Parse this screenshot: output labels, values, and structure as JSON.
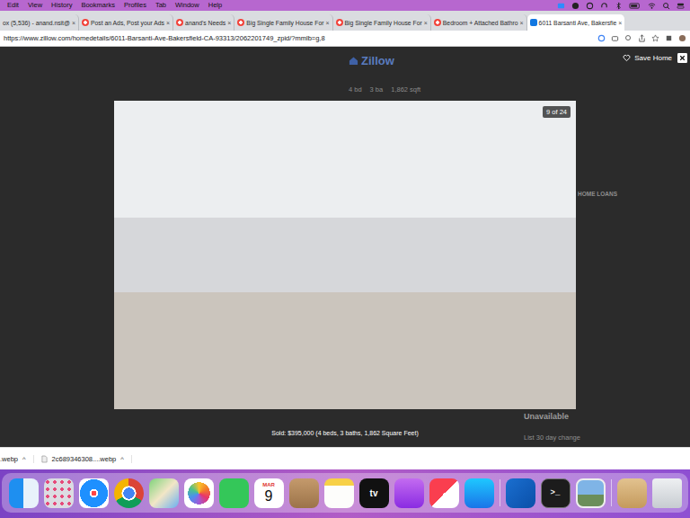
{
  "menu_bar": {
    "items": [
      "Edit",
      "View",
      "History",
      "Bookmarks",
      "Profiles",
      "Tab",
      "Window",
      "Help"
    ]
  },
  "tab_close": "×",
  "tabs": [
    {
      "label": "ox (5,536) - anand.nsit@",
      "selected": false,
      "kind": "none"
    },
    {
      "label": "Post an Ads, Post your Ads",
      "selected": false,
      "kind": "olx"
    },
    {
      "label": "anand's Needs",
      "selected": false,
      "kind": "olx"
    },
    {
      "label": "Big Single Family House For",
      "selected": false,
      "kind": "olx"
    },
    {
      "label": "Big Single Family House For",
      "selected": false,
      "kind": "olx"
    },
    {
      "label": "Bedroom + Attached Bathro",
      "selected": false,
      "kind": "olx"
    },
    {
      "label": "6011 Barsanti Ave, Bakersfie",
      "selected": true,
      "kind": "zillow"
    }
  ],
  "address_bar": {
    "url": "https://www.zillow.com/homedetails/6011-Barsanti-Ave-Bakersfield-CA-93313/2062201749_zpid/?mmlb=g,8"
  },
  "page": {
    "logo": "Zillow",
    "facts": [
      "4 bd",
      "3 ba",
      "1,862 sqft"
    ],
    "save": "Save Home",
    "sidebar_heading": "HOME LOANS",
    "status": "Unavailable",
    "change": "List 30 day change"
  },
  "lightbox": {
    "counter": "9 of 24",
    "caption": "Sold: $395,000 (4 beds, 3 baths, 1,862 Square Feet)"
  },
  "downloads": [
    {
      "name": ".webp",
      "chevron": "^"
    },
    {
      "name": "2c689346308....webp",
      "chevron": "^"
    }
  ],
  "dock": [
    {
      "kind": "finder"
    },
    {
      "kind": "launchpad"
    },
    {
      "kind": "safari"
    },
    {
      "kind": "chrome"
    },
    {
      "kind": "maps"
    },
    {
      "kind": "photos"
    },
    {
      "kind": "facetime"
    },
    {
      "kind": "calendar",
      "month": "MAR",
      "day": "9"
    },
    {
      "kind": "contacts"
    },
    {
      "kind": "notes"
    },
    {
      "kind": "tv",
      "glyph": "tv"
    },
    {
      "kind": "podcasts"
    },
    {
      "kind": "news"
    },
    {
      "kind": "appstore"
    },
    {
      "kind": "separator"
    },
    {
      "kind": "outlook"
    },
    {
      "kind": "terminal",
      "glyph": ">_"
    },
    {
      "kind": "preview"
    },
    {
      "kind": "separator"
    },
    {
      "kind": "archive"
    },
    {
      "kind": "trash"
    }
  ]
}
